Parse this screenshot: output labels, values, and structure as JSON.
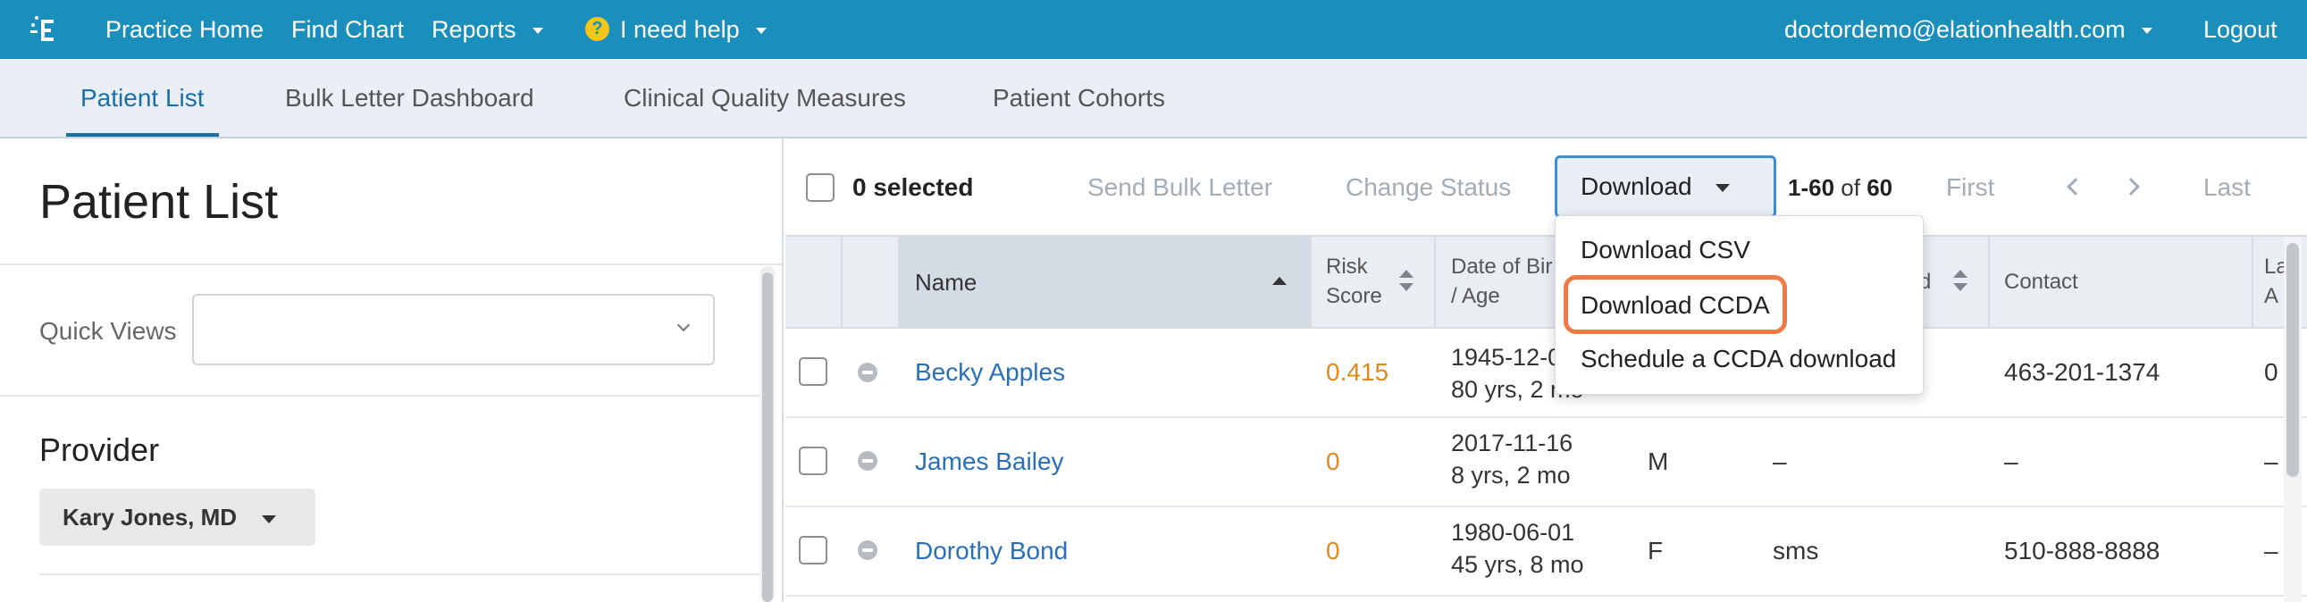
{
  "topbar": {
    "nav": [
      "Practice Home",
      "Find Chart",
      "Reports"
    ],
    "help_icon_glyph": "?",
    "help_label": "I need help",
    "account_email": "doctordemo@elationhealth.com",
    "logout_label": "Logout",
    "background_color": "#1a8fbc"
  },
  "subnav": {
    "tabs": [
      "Patient List",
      "Bulk Letter Dashboard",
      "Clinical Quality Measures",
      "Patient Cohorts"
    ],
    "active_tab": "Patient List"
  },
  "left": {
    "page_title": "Patient List",
    "quick_views_label": "Quick Views",
    "quick_views_value": "",
    "provider_label": "Provider",
    "provider_value": "Kary Jones, MD"
  },
  "toolbar": {
    "selected": "0 selected",
    "send_bulk_letter": "Send Bulk Letter",
    "change_status": "Change Status",
    "download": "Download",
    "range_part": "1-60",
    "of_part": "of",
    "total_part": "60",
    "first": "First",
    "last": "Last"
  },
  "download_menu": {
    "items": [
      "Download CSV",
      "Download CCDA",
      "Schedule a CCDA download"
    ],
    "highlighted": "Download CCDA",
    "highlight_color": "#f07a45"
  },
  "table": {
    "headers": {
      "name": "Name",
      "risk_line1": "Risk",
      "risk_line2": "Score",
      "dob_line1": "Date of Bir",
      "dob_line2": "/ Age",
      "col_partial": "d",
      "contact": "Contact",
      "last_line1": "La",
      "last_line2": "A"
    },
    "rows": [
      {
        "name": "Becky Apples",
        "risk": "0.415",
        "dob": "1945-12-0",
        "age": "80 yrs, 2 mo",
        "sex": "",
        "pref": "",
        "contact": "463-201-1374",
        "last": "0"
      },
      {
        "name": "James Bailey",
        "risk": "0",
        "dob": "2017-11-16",
        "age": "8 yrs, 2 mo",
        "sex": "M",
        "pref": "–",
        "contact": "–",
        "last": "–"
      },
      {
        "name": "Dorothy Bond",
        "risk": "0",
        "dob": "1980-06-01",
        "age": "45 yrs, 8 mo",
        "sex": "F",
        "pref": "sms",
        "contact": "510-888-8888",
        "last": "–"
      }
    ]
  }
}
